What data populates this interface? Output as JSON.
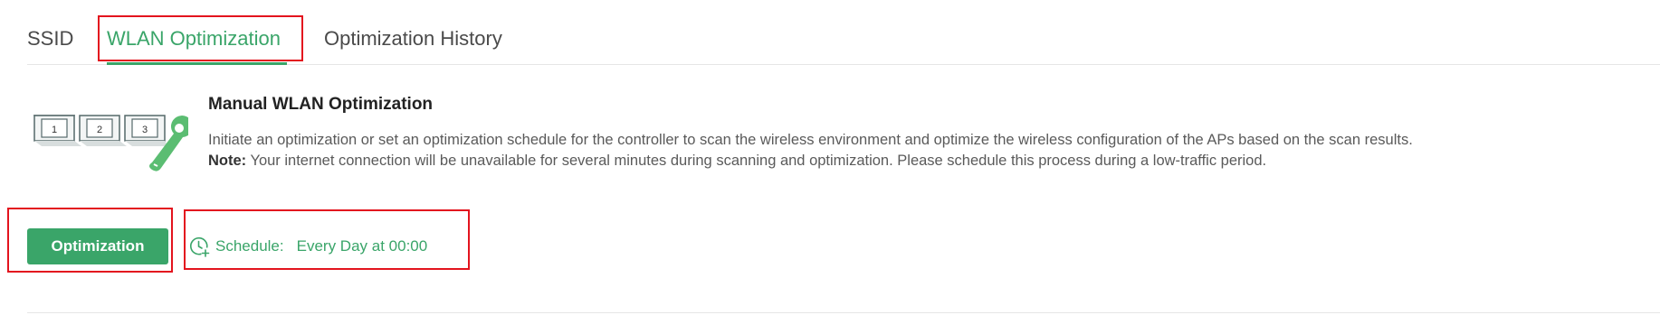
{
  "tabs": [
    {
      "label": "SSID",
      "active": false
    },
    {
      "label": "WLAN Optimization",
      "active": true
    },
    {
      "label": "Optimization History",
      "active": false
    }
  ],
  "manual": {
    "title": "Manual WLAN Optimization",
    "description": "Initiate an optimization or set an optimization schedule for the controller to scan the wireless environment and optimize the wireless configuration of the APs based on the scan results.",
    "note_label": "Note:",
    "note_text": " Your internet connection will be unavailable for several minutes during scanning and optimization. Please schedule this process during a low-traffic period.",
    "illustration_steps": [
      "1",
      "2",
      "3"
    ],
    "illustration_icon": "wrench-icon"
  },
  "actions": {
    "optimization_button": "Optimization",
    "schedule_label": "Schedule:",
    "schedule_value": "Every Day at 00:00",
    "schedule_icon": "clock-add-icon"
  },
  "colors": {
    "accent": "#3aa569",
    "highlight_border": "#e3141e",
    "text": "#5a5a5a"
  }
}
